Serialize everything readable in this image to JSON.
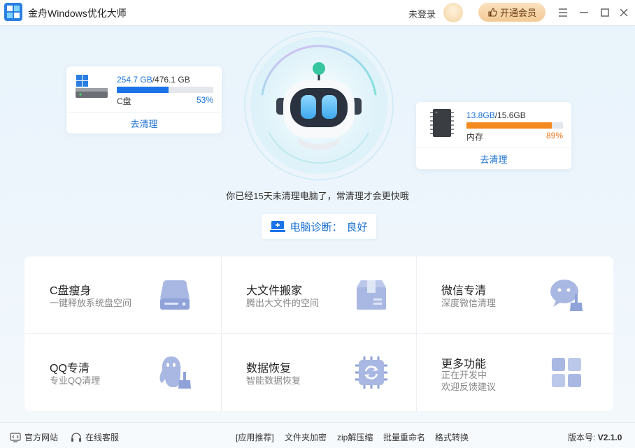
{
  "app": {
    "title": "金舟Windows优化大师",
    "login_status": "未登录",
    "vip_label": "开通会员"
  },
  "disk": {
    "used": "254.7 GB",
    "total": "/476.1 GB",
    "label": "C盘",
    "percent_text": "53%",
    "usage_fraction": 0.535,
    "action": "去清理"
  },
  "memory": {
    "used": "13.8GB",
    "total": "/15.6GB",
    "label": "内存",
    "percent_text": "89%",
    "usage_fraction": 0.885,
    "action": "去清理"
  },
  "hint": "你已经15天未清理电脑了，常清理才会更快哦",
  "diagnosis": {
    "label": "电脑诊断：",
    "status": "良好"
  },
  "features": [
    {
      "title": "C盘瘦身",
      "sub": "一键释放系统盘空间",
      "icon": "disk-icon"
    },
    {
      "title": "大文件搬家",
      "sub": "腾出大文件的空间",
      "icon": "box-icon"
    },
    {
      "title": "微信专清",
      "sub": "深度微信清理",
      "icon": "wechat-clean-icon"
    },
    {
      "title": "QQ专清",
      "sub": "专业QQ清理",
      "icon": "qq-clean-icon"
    },
    {
      "title": "数据恢复",
      "sub": "智能数据恢复",
      "icon": "recovery-icon"
    },
    {
      "title": "更多功能",
      "sub": "正在开发中",
      "sub2": "欢迎反馈建议",
      "icon": "grid-icon"
    }
  ],
  "footer": {
    "website": "官方网站",
    "service": "在线客服",
    "recommend": "[应用推荐]",
    "links": [
      "文件夹加密",
      "zip解压缩",
      "批量重命名",
      "格式转换"
    ],
    "version_label": "版本号:",
    "version": "V2.1.0"
  },
  "colors": {
    "accent": "#1a73e8",
    "memory_bar": "#f48a1f",
    "icon_fill": "#a9b8e2"
  }
}
